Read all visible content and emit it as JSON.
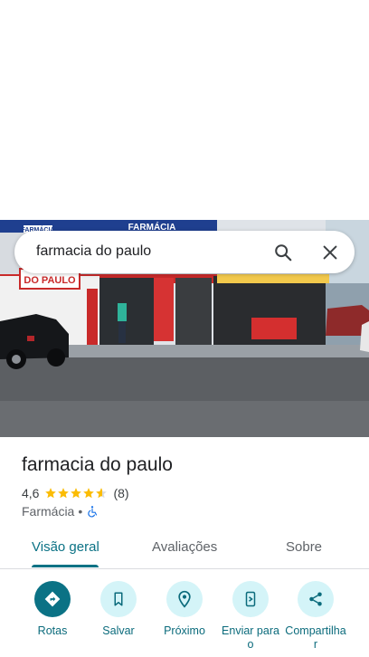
{
  "search": {
    "query": "farmacia do paulo"
  },
  "photo": {
    "sign_top": "FARMÁCIA",
    "sign_top_left": "FARMÁCIA",
    "sign_left": "DO PAULO"
  },
  "place": {
    "name": "farmacia do paulo",
    "rating": "4,6",
    "rating_value": 4.6,
    "review_count": "(8)",
    "category": "Farmácia",
    "separator": "•"
  },
  "tabs": [
    {
      "label": "Visão geral",
      "active": true
    },
    {
      "label": "Avaliações",
      "active": false
    },
    {
      "label": "Sobre",
      "active": false
    }
  ],
  "actions": [
    {
      "label": "Rotas",
      "icon": "directions-icon"
    },
    {
      "label": "Salvar",
      "icon": "bookmark-icon"
    },
    {
      "label": "Próximo",
      "icon": "nearby-icon"
    },
    {
      "label": "Enviar para o",
      "icon": "send-to-phone-icon"
    },
    {
      "label": "Compartilhar",
      "icon": "share-icon"
    }
  ],
  "colors": {
    "accent": "#0b7285",
    "accent_light": "#d4f4f8",
    "star": "#fbbc04"
  }
}
